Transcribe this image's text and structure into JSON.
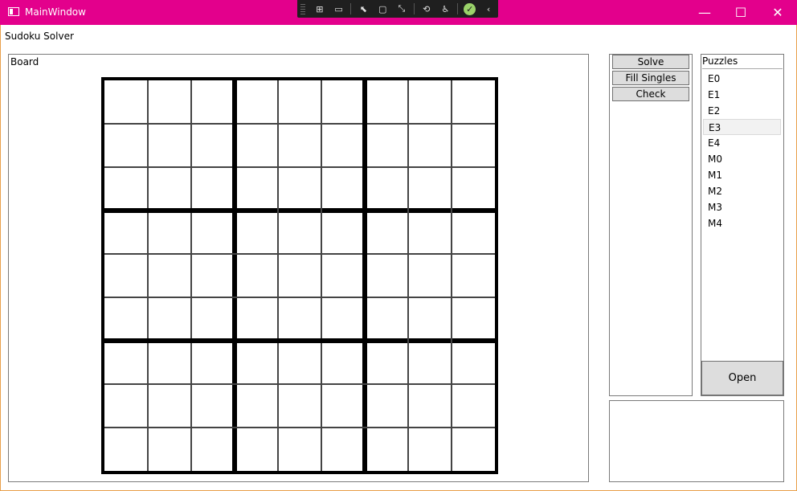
{
  "window": {
    "title": "MainWindow",
    "minimize_glyph": "—",
    "maximize_glyph": "☐",
    "close_glyph": "✕"
  },
  "devbar": {
    "tools": [
      {
        "icon": "live-visual-tree-icon",
        "glyph": "⊞"
      },
      {
        "icon": "record-icon",
        "glyph": "▭"
      },
      {
        "icon": "select-element-icon",
        "glyph": "⬉"
      },
      {
        "icon": "display-layout-adorners-icon",
        "glyph": "▢"
      },
      {
        "icon": "track-focus-icon",
        "glyph": "⤡"
      },
      {
        "icon": "hot-reload-icon",
        "glyph": "⟲"
      },
      {
        "icon": "accessibility-icon",
        "glyph": "♿"
      }
    ],
    "status_glyph": "✓",
    "collapse_glyph": "‹"
  },
  "app_title": "Sudoku Solver",
  "board": {
    "label": "Board",
    "cells": [
      [
        "",
        "",
        "",
        "",
        "",
        "",
        "",
        "",
        ""
      ],
      [
        "",
        "",
        "",
        "",
        "",
        "",
        "",
        "",
        ""
      ],
      [
        "",
        "",
        "",
        "",
        "",
        "",
        "",
        "",
        ""
      ],
      [
        "",
        "",
        "",
        "",
        "",
        "",
        "",
        "",
        ""
      ],
      [
        "",
        "",
        "",
        "",
        "",
        "",
        "",
        "",
        ""
      ],
      [
        "",
        "",
        "",
        "",
        "",
        "",
        "",
        "",
        ""
      ],
      [
        "",
        "",
        "",
        "",
        "",
        "",
        "",
        "",
        ""
      ],
      [
        "",
        "",
        "",
        "",
        "",
        "",
        "",
        "",
        ""
      ],
      [
        "",
        "",
        "",
        "",
        "",
        "",
        "",
        "",
        ""
      ]
    ]
  },
  "controls": {
    "solve_label": "Solve",
    "fill_singles_label": "Fill Singles",
    "check_label": "Check"
  },
  "puzzles": {
    "label": "Puzzles",
    "items": [
      "E0",
      "E1",
      "E2",
      "E3",
      "E4",
      "M0",
      "M1",
      "M2",
      "M3",
      "M4"
    ],
    "selected": "E3",
    "open_label": "Open"
  },
  "output": {
    "text": ""
  },
  "colors": {
    "titlebar": "#e3008c",
    "window_border": "#e8a04a",
    "button_face": "#dddddd"
  }
}
